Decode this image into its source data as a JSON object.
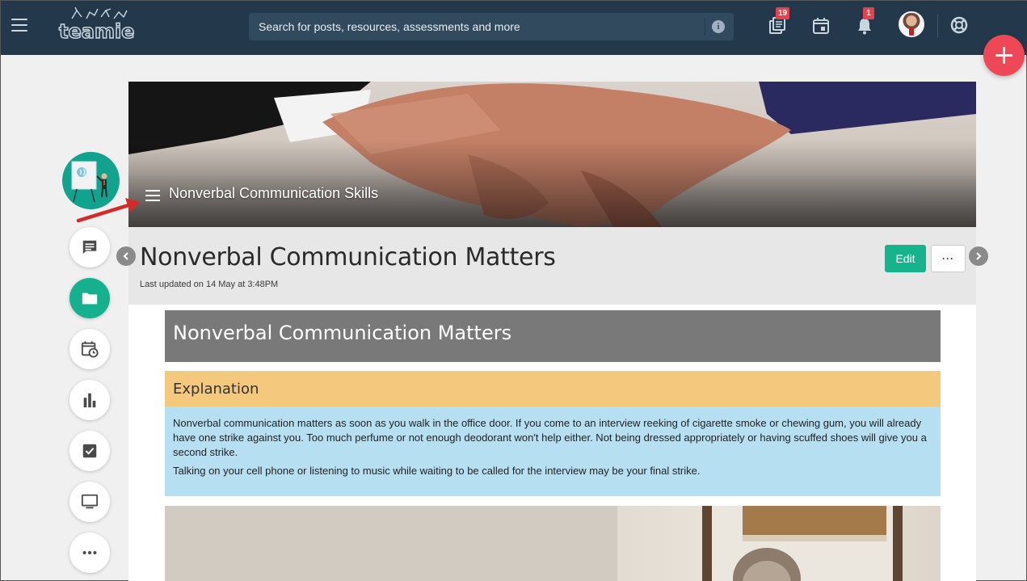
{
  "app": {
    "logo_text": "teamie",
    "search_placeholder": "Search for posts, resources, assessments and more"
  },
  "topbar": {
    "icons": [
      {
        "name": "resources-icon",
        "badge": "19"
      },
      {
        "name": "calendar-icon",
        "badge": ""
      },
      {
        "name": "notifications-icon",
        "badge": "1"
      }
    ]
  },
  "course": {
    "title": "Nonverbal Communication Skills"
  },
  "page": {
    "title": "Nonverbal Communication Matters",
    "updated": "Last updated on 14 May at 3:48PM",
    "edit_label": "Edit",
    "more_label": "···"
  },
  "content": {
    "section_title": "Nonverbal Communication Matters",
    "explanation_heading": "Explanation",
    "paragraphs": [
      "Nonverbal communication matters as soon as you walk in the office door. If you come to an interview reeking of cigarette smoke or chewing gum, you will already have one strike against you. Too much perfume or not enough deodorant won't help either. Not being dressed appropriately or having scuffed shoes will give you a second strike.",
      "Talking on your cell phone or listening to music while waiting to be called for the interview may be your final strike."
    ]
  },
  "colors": {
    "topbar": "#23394b",
    "accent": "#16b48c",
    "fab": "#ee4755",
    "badge": "#e9404f",
    "explanation_head": "#f4c97e",
    "explanation_body": "#b7dff2",
    "section_title_bg": "#797979"
  }
}
